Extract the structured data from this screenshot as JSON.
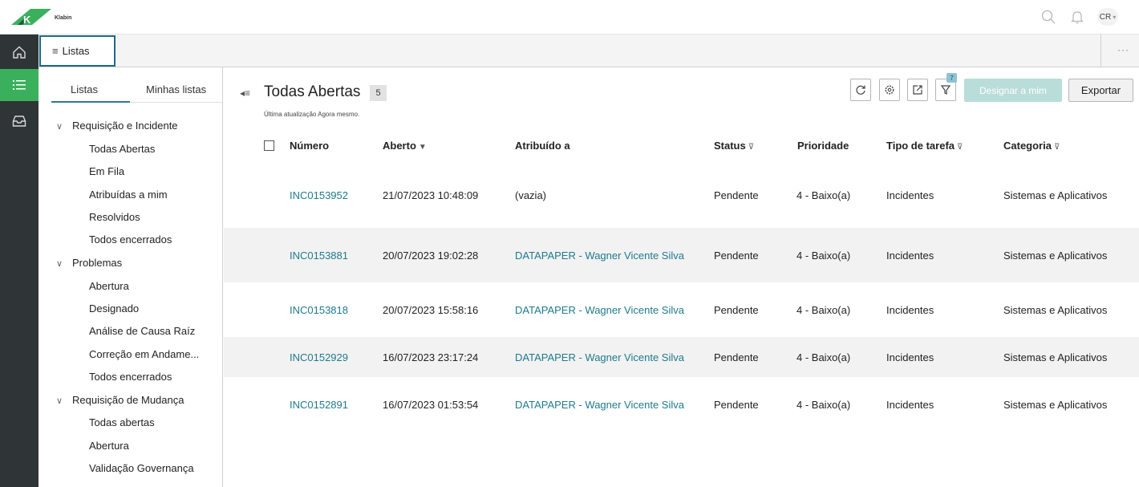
{
  "header": {
    "logo_text": "Klabin",
    "avatar_initials": "CR",
    "icons": [
      "search-icon",
      "bell-icon",
      "chevron-down-icon"
    ]
  },
  "rail": {
    "items": [
      "home-icon",
      "list-icon",
      "inbox-icon"
    ],
    "active_index": 1
  },
  "tabbar": {
    "tab_label": "Listas",
    "more_label": "···"
  },
  "lists_panel": {
    "tabs": [
      "Listas",
      "Minhas listas"
    ],
    "groups": [
      {
        "label": "Requisição e Incidente",
        "items": [
          "Todas Abertas",
          "Em Fila",
          "Atribuídas a mim",
          "Resolvidos",
          "Todos encerrados"
        ]
      },
      {
        "label": "Problemas",
        "items": [
          "Abertura",
          "Designado",
          "Análise de Causa Raíz",
          "Correção em Andame...",
          "Todos encerrados"
        ]
      },
      {
        "label": "Requisição de Mudança",
        "items": [
          "Todas abertas",
          "Abertura",
          "Validação Governança"
        ]
      }
    ]
  },
  "main": {
    "title": "Todas Abertas",
    "count": "5",
    "updated": "Última atualização Agora mesmo.",
    "filter_count": "7",
    "assign_label": "Designar a mim",
    "export_label": "Exportar",
    "toolbar_icons": [
      "refresh-icon",
      "settings-icon",
      "share-icon",
      "filter-icon"
    ],
    "columns": [
      "Número",
      "Aberto",
      "Atribuído a",
      "Status",
      "Prioridade",
      "Tipo de tarefa",
      "Categoria"
    ],
    "sort_glyph": "▼",
    "filter_glyph": "⊽",
    "rows": [
      {
        "numero": "INC0153952",
        "aberto": "21/07/2023 10:48:09",
        "atribuido": "(vazia)",
        "status": "Pendente",
        "prioridade": "4 - Baixo(a)",
        "tipo": "Incidentes",
        "categoria": "Sistemas e Aplicativos"
      },
      {
        "numero": "INC0153881",
        "aberto": "20/07/2023 19:02:28",
        "atribuido": "DATAPAPER - Wagner Vicente Silva",
        "status": "Pendente",
        "prioridade": "4 - Baixo(a)",
        "tipo": "Incidentes",
        "categoria": "Sistemas e Aplicativos"
      },
      {
        "numero": "INC0153818",
        "aberto": "20/07/2023 15:58:16",
        "atribuido": "DATAPAPER - Wagner Vicente Silva",
        "status": "Pendente",
        "prioridade": "4 - Baixo(a)",
        "tipo": "Incidentes",
        "categoria": "Sistemas e Aplicativos"
      },
      {
        "numero": "INC0152929",
        "aberto": "16/07/2023 23:17:24",
        "atribuido": "DATAPAPER - Wagner Vicente Silva",
        "status": "Pendente",
        "prioridade": "4 - Baixo(a)",
        "tipo": "Incidentes",
        "categoria": "Sistemas e Aplicativos"
      },
      {
        "numero": "INC0152891",
        "aberto": "16/07/2023 01:53:54",
        "atribuido": "DATAPAPER - Wagner Vicente Silva",
        "status": "Pendente",
        "prioridade": "4 - Baixo(a)",
        "tipo": "Incidentes",
        "categoria": "Sistemas e Aplicativos"
      }
    ]
  },
  "colors": {
    "accent_green": "#3bb05c",
    "link_teal": "#1f7a8c",
    "rail_bg": "#2f3437",
    "assign_disabled": "#b9ddd9"
  }
}
